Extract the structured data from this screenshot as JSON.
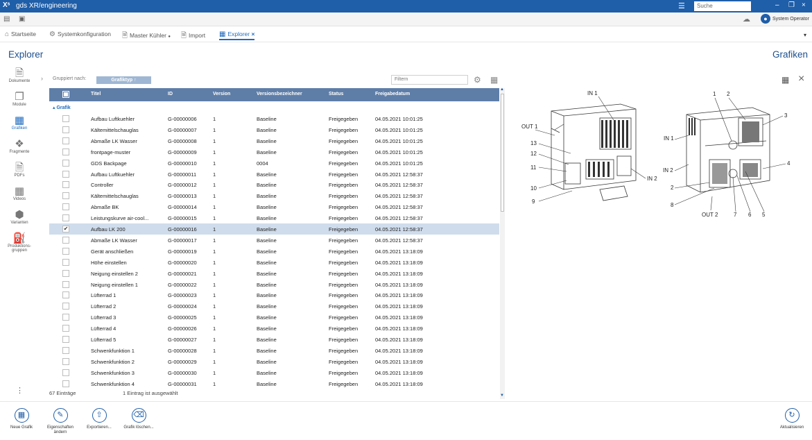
{
  "window": {
    "logo": "Xˢ",
    "title": "gds XR/engineering",
    "search_placeholder": "Suche",
    "user": "System Operator"
  },
  "tabs": [
    {
      "label": "Startseite",
      "icon": "home-icon"
    },
    {
      "label": "Systemkonfiguration",
      "icon": "gear-icon"
    },
    {
      "label": "Master Kühler",
      "icon": "document-icon",
      "suffix": "●"
    },
    {
      "label": "Import",
      "icon": "import-icon"
    },
    {
      "label": "Explorer",
      "icon": "explorer-icon",
      "suffix": "×",
      "active": true
    }
  ],
  "page": {
    "title": "Explorer",
    "preview_title": "Grafiken"
  },
  "sidebar": [
    {
      "label": "Dokumente",
      "icon": "document-icon"
    },
    {
      "label": "Module",
      "icon": "module-icon"
    },
    {
      "label": "Grafiken",
      "icon": "image-icon",
      "active": true
    },
    {
      "label": "Fragmente",
      "icon": "puzzle-icon"
    },
    {
      "label": "PDFs",
      "icon": "pdf-icon"
    },
    {
      "label": "Videos",
      "icon": "video-icon"
    },
    {
      "label": "Varianten",
      "icon": "cube-icon"
    },
    {
      "label": "Produktions-gruppen",
      "icon": "factory-icon"
    }
  ],
  "grouping": {
    "label": "Gruppiert nach:",
    "chip": "Grafiktyp ↑",
    "filter_placeholder": "Filtern"
  },
  "table": {
    "columns": [
      "Titel",
      "ID",
      "Version",
      "Versionsbezeichner",
      "Status",
      "Freigabedatum"
    ],
    "group": "▴ Grafik",
    "rows": [
      [
        "Aufbau Luftkuehler",
        "G-00000006",
        "1",
        "Baseline",
        "Freigegeben",
        "04.05.2021 10:01:25"
      ],
      [
        "Kältemittelschauglas",
        "G-00000007",
        "1",
        "Baseline",
        "Freigegeben",
        "04.05.2021 10:01:25"
      ],
      [
        "Abmaße LK Wasser",
        "G-00000008",
        "1",
        "Baseline",
        "Freigegeben",
        "04.05.2021 10:01:25"
      ],
      [
        "frontpage-muster",
        "G-00000009",
        "1",
        "Baseline",
        "Freigegeben",
        "04.05.2021 10:01:25"
      ],
      [
        "GDS Backpage",
        "G-00000010",
        "1",
        "0004",
        "Freigegeben",
        "04.05.2021 10:01:25"
      ],
      [
        "Aufbau Luftkuehler",
        "G-00000011",
        "1",
        "Baseline",
        "Freigegeben",
        "04.05.2021 12:58:37"
      ],
      [
        "Controller",
        "G-00000012",
        "1",
        "Baseline",
        "Freigegeben",
        "04.05.2021 12:58:37"
      ],
      [
        "Kältemittelschauglas",
        "G-00000013",
        "1",
        "Baseline",
        "Freigegeben",
        "04.05.2021 12:58:37"
      ],
      [
        "Abmaße BK",
        "G-00000014",
        "1",
        "Baseline",
        "Freigegeben",
        "04.05.2021 12:58:37"
      ],
      [
        "Leistungskurve air-cool...",
        "G-00000015",
        "1",
        "Baseline",
        "Freigegeben",
        "04.05.2021 12:58:37"
      ],
      [
        "Aufbau LK 200",
        "G-00000016",
        "1",
        "Baseline",
        "Freigegeben",
        "04.05.2021 12:58:37"
      ],
      [
        "Abmaße LK Wasser",
        "G-00000017",
        "1",
        "Baseline",
        "Freigegeben",
        "04.05.2021 12:58:37"
      ],
      [
        "Gerät anschließen",
        "G-00000019",
        "1",
        "Baseline",
        "Freigegeben",
        "04.05.2021 13:18:09"
      ],
      [
        "Höhe einstellen",
        "G-00000020",
        "1",
        "Baseline",
        "Freigegeben",
        "04.05.2021 13:18:09"
      ],
      [
        "Neigung einstellen 2",
        "G-00000021",
        "1",
        "Baseline",
        "Freigegeben",
        "04.05.2021 13:18:09"
      ],
      [
        "Neigung einstellen 1",
        "G-00000022",
        "1",
        "Baseline",
        "Freigegeben",
        "04.05.2021 13:18:09"
      ],
      [
        "Lüfterrad 1",
        "G-00000023",
        "1",
        "Baseline",
        "Freigegeben",
        "04.05.2021 13:18:09"
      ],
      [
        "Lüfterrad 2",
        "G-00000024",
        "1",
        "Baseline",
        "Freigegeben",
        "04.05.2021 13:18:09"
      ],
      [
        "Lüfterrad 3",
        "G-00000025",
        "1",
        "Baseline",
        "Freigegeben",
        "04.05.2021 13:18:09"
      ],
      [
        "Lüfterrad 4",
        "G-00000026",
        "1",
        "Baseline",
        "Freigegeben",
        "04.05.2021 13:18:09"
      ],
      [
        "Lüfterrad 5",
        "G-00000027",
        "1",
        "Baseline",
        "Freigegeben",
        "04.05.2021 13:18:09"
      ],
      [
        "Schwenkfunktion 1",
        "G-00000028",
        "1",
        "Baseline",
        "Freigegeben",
        "04.05.2021 13:18:09"
      ],
      [
        "Schwenkfunktion 2",
        "G-00000029",
        "1",
        "Baseline",
        "Freigegeben",
        "04.05.2021 13:18:09"
      ],
      [
        "Schwenkfunktion 3",
        "G-00000030",
        "1",
        "Baseline",
        "Freigegeben",
        "04.05.2021 13:18:09"
      ],
      [
        "Schwenkfunktion 4",
        "G-00000031",
        "1",
        "Baseline",
        "Freigegeben",
        "04.05.2021 13:18:09"
      ]
    ],
    "selected_index": 10
  },
  "status": {
    "count": "67 Einträge",
    "selection": "1 Eintrag ist ausgewählt"
  },
  "toolbar": [
    {
      "label": "Neue Grafik",
      "icon": "new-image-icon"
    },
    {
      "label": "Eigenschaften ändern",
      "icon": "edit-icon"
    },
    {
      "label": "Exportieren...",
      "icon": "export-icon"
    },
    {
      "label": "Grafik löschen...",
      "icon": "trash-icon"
    }
  ],
  "refresh": {
    "label": "Aktualisieren",
    "icon": "refresh-icon"
  },
  "drawing": {
    "left_labels": [
      "IN 1",
      "OUT 1",
      "13",
      "12",
      "11",
      "10",
      "9",
      "IN 2"
    ],
    "right_labels": [
      "1",
      "2",
      "3",
      "IN 1",
      "IN 2",
      "4",
      "2",
      "8",
      "7",
      "6",
      "5",
      "OUT 2"
    ]
  }
}
